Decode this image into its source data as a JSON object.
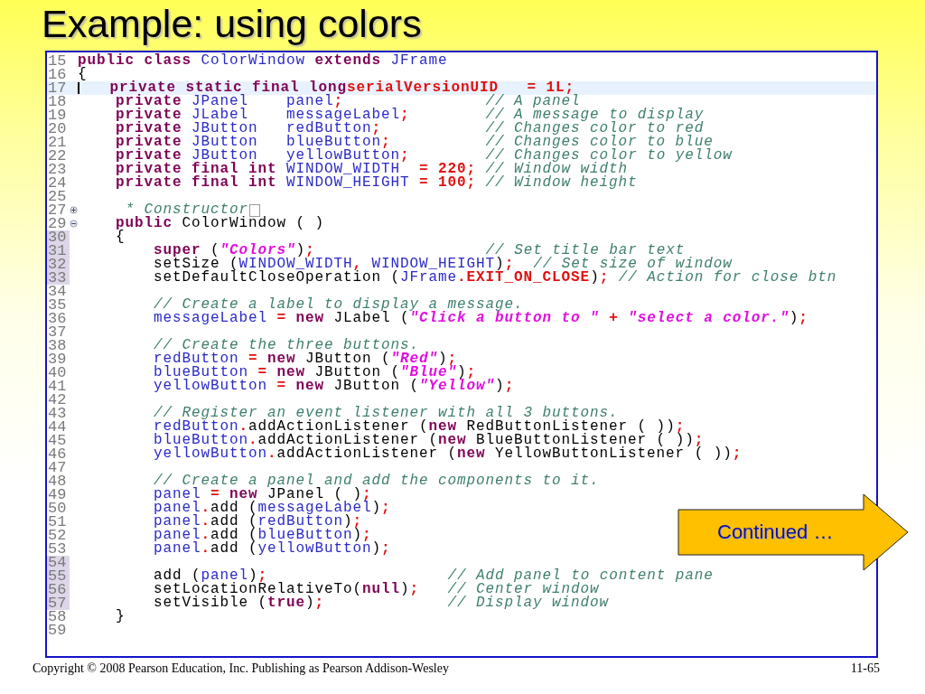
{
  "slide": {
    "title": "Example: using colors",
    "footer_left": "Copyright © 2008 Pearson Education, Inc. Publishing as Pearson Addison-Wesley",
    "footer_right": "11-65",
    "callout": "Continued …"
  },
  "editor": {
    "lines": [
      {
        "number": "15",
        "highlighted": false,
        "marked": false,
        "segments": [
          {
            "kind": "kw",
            "text": "public class "
          },
          {
            "kind": "id",
            "text": "ColorWindow "
          },
          {
            "kind": "kw",
            "text": "extends "
          },
          {
            "kind": "id",
            "text": "JFrame"
          }
        ]
      },
      {
        "number": "16",
        "highlighted": false,
        "marked": false,
        "segments": [
          {
            "kind": "plain",
            "text": "{"
          }
        ]
      },
      {
        "number": "17",
        "highlighted": true,
        "marked": false,
        "segments": [
          {
            "kind": "kw",
            "text": "   private static final long"
          },
          {
            "kind": "const",
            "text": "serialVersionUID   = 1L;"
          }
        ]
      },
      {
        "number": "18",
        "highlighted": false,
        "marked": false,
        "segments": [
          {
            "kind": "kw",
            "text": "    private "
          },
          {
            "kind": "id",
            "text": "JPanel    panel"
          },
          {
            "kind": "punct",
            "text": ";"
          },
          {
            "kind": "cmt",
            "text": "               // A panel"
          }
        ]
      },
      {
        "number": "19",
        "highlighted": false,
        "marked": false,
        "segments": [
          {
            "kind": "kw",
            "text": "    private "
          },
          {
            "kind": "id",
            "text": "JLabel    messageLabel"
          },
          {
            "kind": "punct",
            "text": ";"
          },
          {
            "kind": "cmt",
            "text": "        // A message to display"
          }
        ]
      },
      {
        "number": "20",
        "highlighted": false,
        "marked": false,
        "segments": [
          {
            "kind": "kw",
            "text": "    private "
          },
          {
            "kind": "id",
            "text": "JButton   redButton"
          },
          {
            "kind": "punct",
            "text": ";"
          },
          {
            "kind": "cmt",
            "text": "           // Changes color to red"
          }
        ]
      },
      {
        "number": "21",
        "highlighted": false,
        "marked": false,
        "segments": [
          {
            "kind": "kw",
            "text": "    private "
          },
          {
            "kind": "id",
            "text": "JButton   blueButton"
          },
          {
            "kind": "punct",
            "text": ";"
          },
          {
            "kind": "cmt",
            "text": "          // Changes color to blue"
          }
        ]
      },
      {
        "number": "22",
        "highlighted": false,
        "marked": false,
        "segments": [
          {
            "kind": "kw",
            "text": "    private "
          },
          {
            "kind": "id",
            "text": "JButton   yellowButton"
          },
          {
            "kind": "punct",
            "text": ";"
          },
          {
            "kind": "cmt",
            "text": "        // Changes color to yellow"
          }
        ]
      },
      {
        "number": "23",
        "highlighted": false,
        "marked": false,
        "segments": [
          {
            "kind": "kw",
            "text": "    private final int "
          },
          {
            "kind": "id",
            "text": "WINDOW_WIDTH  "
          },
          {
            "kind": "const",
            "text": "= 220;"
          },
          {
            "kind": "cmt",
            "text": " // Window width"
          }
        ]
      },
      {
        "number": "24",
        "highlighted": false,
        "marked": false,
        "segments": [
          {
            "kind": "kw",
            "text": "    private final int "
          },
          {
            "kind": "id",
            "text": "WINDOW_HEIGHT "
          },
          {
            "kind": "const",
            "text": "= 100;"
          },
          {
            "kind": "cmt",
            "text": " // Window height"
          }
        ]
      },
      {
        "number": "25",
        "highlighted": false,
        "marked": false
      },
      {
        "number": "27",
        "highlighted": false,
        "marked": false,
        "fold": {
          "collapsed": true
        },
        "segments": [
          {
            "kind": "cmt",
            "text": "     * Constructor"
          }
        ]
      },
      {
        "number": "29",
        "highlighted": false,
        "marked": false,
        "fold": {
          "collapsed": false
        },
        "segments": [
          {
            "kind": "kw",
            "text": "    public "
          },
          {
            "kind": "plain",
            "text": "ColorWindow ( )"
          }
        ]
      },
      {
        "number": "30",
        "highlighted": false,
        "marked": true,
        "segments": [
          {
            "kind": "plain",
            "text": "    {"
          }
        ]
      },
      {
        "number": "31",
        "highlighted": false,
        "marked": true,
        "segments": [
          {
            "kind": "kw",
            "text": "        super "
          },
          {
            "kind": "plain",
            "text": "("
          },
          {
            "kind": "str",
            "text": "\"Colors\""
          },
          {
            "kind": "plain",
            "text": ")"
          },
          {
            "kind": "punct",
            "text": ";"
          },
          {
            "kind": "cmt",
            "text": "                  // Set title bar text"
          }
        ]
      },
      {
        "number": "32",
        "highlighted": false,
        "marked": true,
        "segments": [
          {
            "kind": "plain",
            "text": "        setSize ("
          },
          {
            "kind": "id",
            "text": "WINDOW_WIDTH"
          },
          {
            "kind": "punct",
            "text": ", "
          },
          {
            "kind": "id",
            "text": "WINDOW_HEIGHT"
          },
          {
            "kind": "plain",
            "text": ")"
          },
          {
            "kind": "punct",
            "text": ";"
          },
          {
            "kind": "cmt",
            "text": "  // Set size of window"
          }
        ]
      },
      {
        "number": "33",
        "highlighted": false,
        "marked": true,
        "segments": [
          {
            "kind": "plain",
            "text": "        setDefaultCloseOperation ("
          },
          {
            "kind": "id",
            "text": "JFrame"
          },
          {
            "kind": "punct",
            "text": "."
          },
          {
            "kind": "const",
            "text": "EXIT_ON_CLOSE"
          },
          {
            "kind": "plain",
            "text": ")"
          },
          {
            "kind": "punct",
            "text": ";"
          },
          {
            "kind": "cmt",
            "text": " // Action for close btn"
          }
        ]
      },
      {
        "number": "34",
        "highlighted": false,
        "marked": false
      },
      {
        "number": "35",
        "highlighted": false,
        "marked": false,
        "segments": [
          {
            "kind": "cmt",
            "text": "        // Create a label to display a message."
          }
        ]
      },
      {
        "number": "36",
        "highlighted": false,
        "marked": false,
        "segments": [
          {
            "kind": "id",
            "text": "        messageLabel "
          },
          {
            "kind": "punct",
            "text": "= "
          },
          {
            "kind": "kw",
            "text": "new "
          },
          {
            "kind": "plain",
            "text": "JLabel ("
          },
          {
            "kind": "str",
            "text": "\"Click a button to \""
          },
          {
            "kind": "punct",
            "text": " + "
          },
          {
            "kind": "str",
            "text": "\"select a color.\""
          },
          {
            "kind": "plain",
            "text": ")"
          },
          {
            "kind": "punct",
            "text": ";"
          }
        ]
      },
      {
        "number": "37",
        "highlighted": false,
        "marked": false
      },
      {
        "number": "38",
        "highlighted": false,
        "marked": false,
        "segments": [
          {
            "kind": "cmt",
            "text": "        // Create the three buttons."
          }
        ]
      },
      {
        "number": "39",
        "highlighted": false,
        "marked": false,
        "segments": [
          {
            "kind": "id",
            "text": "        redButton "
          },
          {
            "kind": "punct",
            "text": "= "
          },
          {
            "kind": "kw",
            "text": "new "
          },
          {
            "kind": "plain",
            "text": "JButton ("
          },
          {
            "kind": "str",
            "text": "\"Red\""
          },
          {
            "kind": "plain",
            "text": ")"
          },
          {
            "kind": "punct",
            "text": ";"
          }
        ]
      },
      {
        "number": "40",
        "highlighted": false,
        "marked": false,
        "segments": [
          {
            "kind": "id",
            "text": "        blueButton "
          },
          {
            "kind": "punct",
            "text": "= "
          },
          {
            "kind": "kw",
            "text": "new "
          },
          {
            "kind": "plain",
            "text": "JButton ("
          },
          {
            "kind": "str",
            "text": "\"Blue\""
          },
          {
            "kind": "plain",
            "text": ")"
          },
          {
            "kind": "punct",
            "text": ";"
          }
        ]
      },
      {
        "number": "41",
        "highlighted": false,
        "marked": false,
        "segments": [
          {
            "kind": "id",
            "text": "        yellowButton "
          },
          {
            "kind": "punct",
            "text": "= "
          },
          {
            "kind": "kw",
            "text": "new "
          },
          {
            "kind": "plain",
            "text": "JButton ("
          },
          {
            "kind": "str",
            "text": "\"Yellow\""
          },
          {
            "kind": "plain",
            "text": ")"
          },
          {
            "kind": "punct",
            "text": ";"
          }
        ]
      },
      {
        "number": "42",
        "highlighted": false,
        "marked": false
      },
      {
        "number": "43",
        "highlighted": false,
        "marked": false,
        "segments": [
          {
            "kind": "cmt",
            "text": "        // Register an event listener with all 3 buttons."
          }
        ]
      },
      {
        "number": "44",
        "highlighted": false,
        "marked": false,
        "segments": [
          {
            "kind": "id",
            "text": "        redButton"
          },
          {
            "kind": "punct",
            "text": "."
          },
          {
            "kind": "plain",
            "text": "addActionListener ("
          },
          {
            "kind": "kw",
            "text": "new "
          },
          {
            "kind": "plain",
            "text": "RedButtonListener ( ))"
          },
          {
            "kind": "punct",
            "text": ";"
          }
        ]
      },
      {
        "number": "45",
        "highlighted": false,
        "marked": false,
        "segments": [
          {
            "kind": "id",
            "text": "        blueButton"
          },
          {
            "kind": "punct",
            "text": "."
          },
          {
            "kind": "plain",
            "text": "addActionListener ("
          },
          {
            "kind": "kw",
            "text": "new "
          },
          {
            "kind": "plain",
            "text": "BlueButtonListener ( ))"
          },
          {
            "kind": "punct",
            "text": ";"
          }
        ]
      },
      {
        "number": "46",
        "highlighted": false,
        "marked": false,
        "segments": [
          {
            "kind": "id",
            "text": "        yellowButton"
          },
          {
            "kind": "punct",
            "text": "."
          },
          {
            "kind": "plain",
            "text": "addActionListener ("
          },
          {
            "kind": "kw",
            "text": "new "
          },
          {
            "kind": "plain",
            "text": "YellowButtonListener ( ))"
          },
          {
            "kind": "punct",
            "text": ";"
          }
        ]
      },
      {
        "number": "47",
        "highlighted": false,
        "marked": false
      },
      {
        "number": "48",
        "highlighted": false,
        "marked": false,
        "segments": [
          {
            "kind": "cmt",
            "text": "        // Create a panel and add the components to it."
          }
        ]
      },
      {
        "number": "49",
        "highlighted": false,
        "marked": false,
        "segments": [
          {
            "kind": "id",
            "text": "        panel "
          },
          {
            "kind": "punct",
            "text": "= "
          },
          {
            "kind": "kw",
            "text": "new "
          },
          {
            "kind": "plain",
            "text": "JPanel ( )"
          },
          {
            "kind": "punct",
            "text": ";"
          }
        ]
      },
      {
        "number": "50",
        "highlighted": false,
        "marked": false,
        "segments": [
          {
            "kind": "id",
            "text": "        panel"
          },
          {
            "kind": "punct",
            "text": "."
          },
          {
            "kind": "plain",
            "text": "add ("
          },
          {
            "kind": "id",
            "text": "messageLabel"
          },
          {
            "kind": "plain",
            "text": ")"
          },
          {
            "kind": "punct",
            "text": ";"
          }
        ]
      },
      {
        "number": "51",
        "highlighted": false,
        "marked": false,
        "segments": [
          {
            "kind": "id",
            "text": "        panel"
          },
          {
            "kind": "punct",
            "text": "."
          },
          {
            "kind": "plain",
            "text": "add ("
          },
          {
            "kind": "id",
            "text": "redButton"
          },
          {
            "kind": "plain",
            "text": ")"
          },
          {
            "kind": "punct",
            "text": ";"
          }
        ]
      },
      {
        "number": "52",
        "highlighted": false,
        "marked": false,
        "segments": [
          {
            "kind": "id",
            "text": "        panel"
          },
          {
            "kind": "punct",
            "text": "."
          },
          {
            "kind": "plain",
            "text": "add ("
          },
          {
            "kind": "id",
            "text": "blueButton"
          },
          {
            "kind": "plain",
            "text": ")"
          },
          {
            "kind": "punct",
            "text": ";"
          }
        ]
      },
      {
        "number": "53",
        "highlighted": false,
        "marked": false,
        "segments": [
          {
            "kind": "id",
            "text": "        panel"
          },
          {
            "kind": "punct",
            "text": "."
          },
          {
            "kind": "plain",
            "text": "add ("
          },
          {
            "kind": "id",
            "text": "yellowButton"
          },
          {
            "kind": "plain",
            "text": ")"
          },
          {
            "kind": "punct",
            "text": ";"
          }
        ]
      },
      {
        "number": "54",
        "highlighted": false,
        "marked": true
      },
      {
        "number": "55",
        "highlighted": false,
        "marked": true,
        "segments": [
          {
            "kind": "plain",
            "text": "        add ("
          },
          {
            "kind": "id",
            "text": "panel"
          },
          {
            "kind": "plain",
            "text": ")"
          },
          {
            "kind": "punct",
            "text": ";"
          },
          {
            "kind": "cmt",
            "text": "                   // Add panel to content pane"
          }
        ]
      },
      {
        "number": "56",
        "highlighted": false,
        "marked": true,
        "segments": [
          {
            "kind": "plain",
            "text": "        setLocationRelativeTo("
          },
          {
            "kind": "kw",
            "text": "null"
          },
          {
            "kind": "plain",
            "text": ")"
          },
          {
            "kind": "punct",
            "text": ";"
          },
          {
            "kind": "cmt",
            "text": "   // Center window"
          }
        ]
      },
      {
        "number": "57",
        "highlighted": false,
        "marked": true,
        "segments": [
          {
            "kind": "plain",
            "text": "        setVisible ("
          },
          {
            "kind": "kw",
            "text": "true"
          },
          {
            "kind": "plain",
            "text": ")"
          },
          {
            "kind": "punct",
            "text": ";"
          },
          {
            "kind": "cmt",
            "text": "             // Display window"
          }
        ]
      },
      {
        "number": "58",
        "highlighted": false,
        "marked": false,
        "segments": [
          {
            "kind": "plain",
            "text": "    }"
          }
        ]
      },
      {
        "number": "59",
        "highlighted": false,
        "marked": false
      }
    ]
  }
}
